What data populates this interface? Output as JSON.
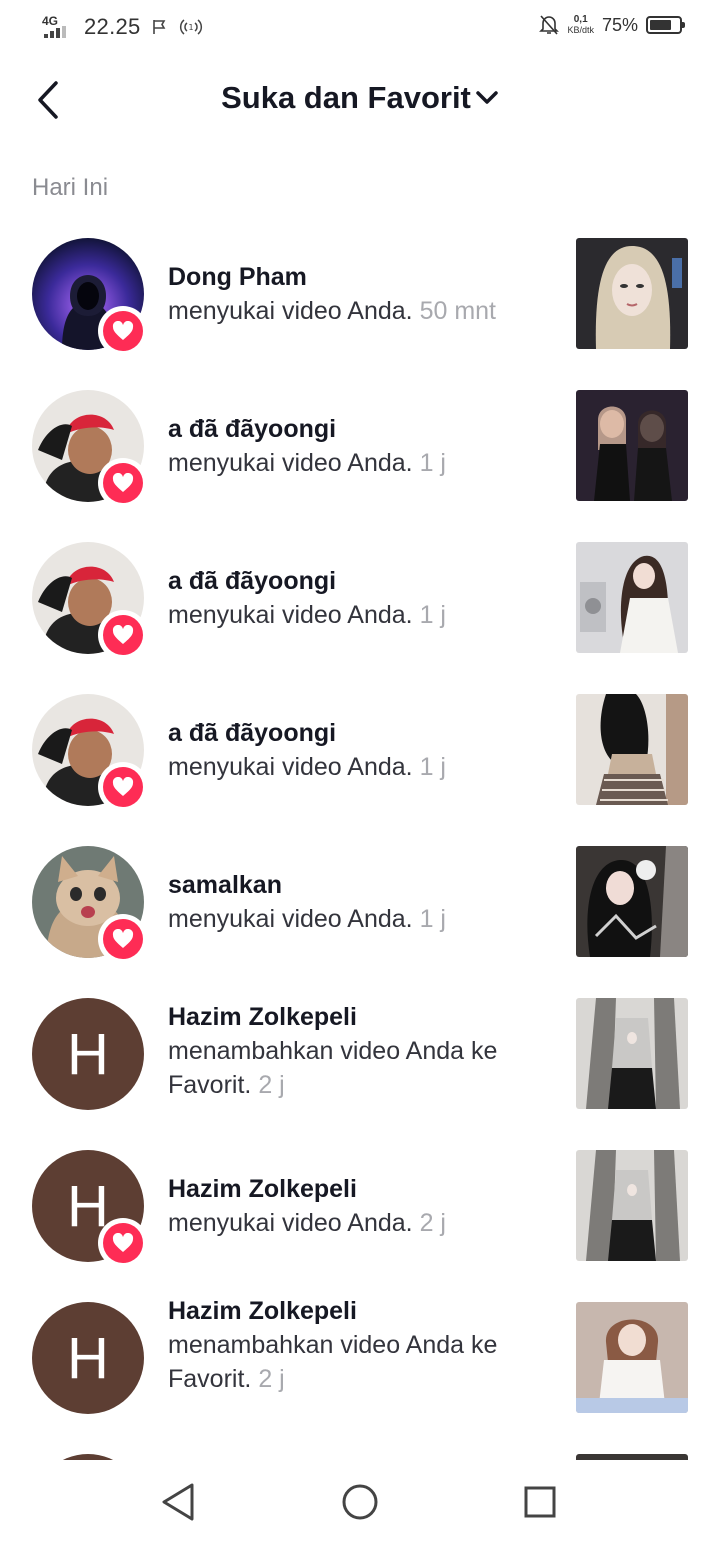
{
  "status": {
    "network": "4G",
    "time": "22.25",
    "speed_value": "0,1",
    "speed_unit": "KB/dtk",
    "battery": "75%"
  },
  "header": {
    "title": "Suka dan Favorit"
  },
  "section": "Hari Ini",
  "notifications": [
    {
      "name": "Dong Pham",
      "message": "menyukai video Anda.",
      "time": "50 mnt"
    },
    {
      "name": "a đã đãyoongi",
      "message": "menyukai video Anda.",
      "time": "1 j"
    },
    {
      "name": "a đã đãyoongi",
      "message": "menyukai video Anda.",
      "time": "1 j"
    },
    {
      "name": "a đã đãyoongi",
      "message": "menyukai video Anda.",
      "time": "1 j"
    },
    {
      "name": "samalkan",
      "message": "menyukai video Anda.",
      "time": "1 j"
    },
    {
      "name": "Hazim Zolkepeli",
      "message": "menambahkan video Anda ke Favorit.",
      "time": "2 j",
      "avatar_letter": "H"
    },
    {
      "name": "Hazim Zolkepeli",
      "message": "menyukai video Anda.",
      "time": "2 j",
      "avatar_letter": "H"
    },
    {
      "name": "Hazim Zolkepeli",
      "message": "menambahkan video Anda ke Favorit.",
      "time": "2 j",
      "avatar_letter": "H"
    }
  ],
  "colors": {
    "accent": "#fe2c55",
    "letter_avatar": "#5d3e33"
  }
}
